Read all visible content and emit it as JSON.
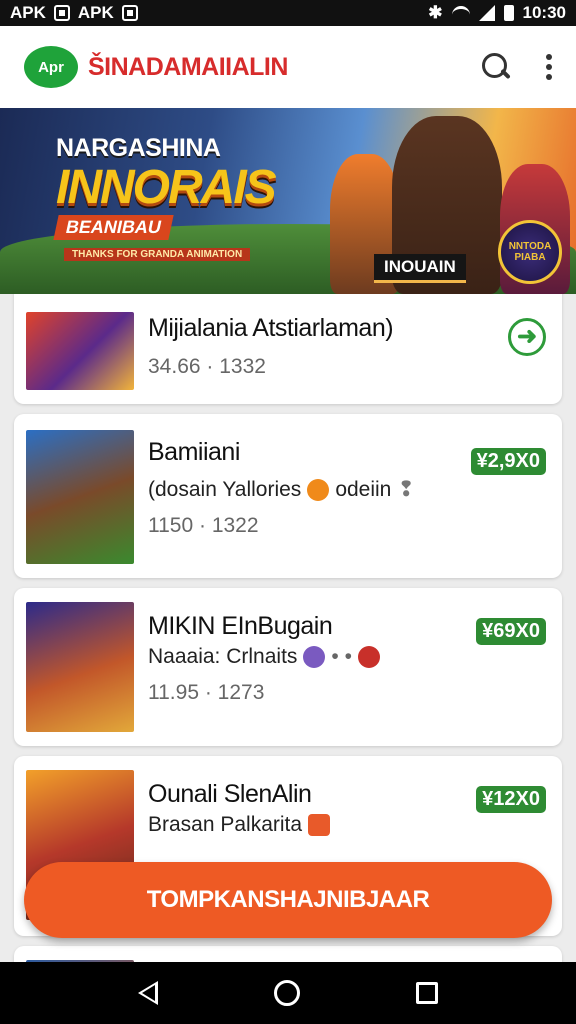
{
  "status_bar": {
    "left_items": [
      "APK",
      "APK"
    ],
    "time": "10:30"
  },
  "app_bar": {
    "logo_text": "Apr",
    "title": "ŠINADAMAIIALIN"
  },
  "banner": {
    "eyebrow": "NARGASHINA",
    "title": "INNORAIS",
    "subtitle": "BEANIBAU",
    "strip": "THANKS FOR GRANDA ANIMATION",
    "badge": "INOUAIN",
    "emblem": "NNTODA PIABA"
  },
  "list": {
    "items": [
      {
        "title": "Mijialania Atstiarlaman)",
        "meta": "34.66 · 1332",
        "action": "arrow"
      },
      {
        "title": "Bamiiani",
        "subtitle": "(dosain Yallories",
        "subtitle_extra": "odeiin",
        "meta": "1150 · 1322",
        "price": "¥2,9X0"
      },
      {
        "title": "MIKIN EInBugain",
        "subtitle": "Naaaia: Crlnaits",
        "meta": "11.95 · 1273",
        "price": "¥69X0"
      },
      {
        "title": "Ounali SlenAlin",
        "subtitle": "Brasan Palkarita",
        "meta": "",
        "price": "¥12X0"
      }
    ]
  },
  "cta": {
    "label": "TOMPKANSHAJNIBJAAR"
  },
  "colors": {
    "accent_green": "#2e8b33",
    "brand_red": "#d72c2c",
    "cta_orange": "#ee5a24"
  }
}
